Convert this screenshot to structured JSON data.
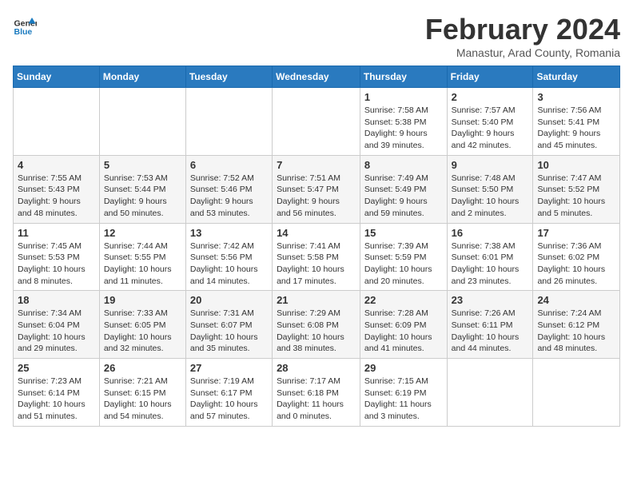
{
  "logo": {
    "line1": "General",
    "line2": "Blue"
  },
  "title": "February 2024",
  "subtitle": "Manastur, Arad County, Romania",
  "weekdays": [
    "Sunday",
    "Monday",
    "Tuesday",
    "Wednesday",
    "Thursday",
    "Friday",
    "Saturday"
  ],
  "weeks": [
    [
      {
        "day": "",
        "info": ""
      },
      {
        "day": "",
        "info": ""
      },
      {
        "day": "",
        "info": ""
      },
      {
        "day": "",
        "info": ""
      },
      {
        "day": "1",
        "info": "Sunrise: 7:58 AM\nSunset: 5:38 PM\nDaylight: 9 hours\nand 39 minutes."
      },
      {
        "day": "2",
        "info": "Sunrise: 7:57 AM\nSunset: 5:40 PM\nDaylight: 9 hours\nand 42 minutes."
      },
      {
        "day": "3",
        "info": "Sunrise: 7:56 AM\nSunset: 5:41 PM\nDaylight: 9 hours\nand 45 minutes."
      }
    ],
    [
      {
        "day": "4",
        "info": "Sunrise: 7:55 AM\nSunset: 5:43 PM\nDaylight: 9 hours\nand 48 minutes."
      },
      {
        "day": "5",
        "info": "Sunrise: 7:53 AM\nSunset: 5:44 PM\nDaylight: 9 hours\nand 50 minutes."
      },
      {
        "day": "6",
        "info": "Sunrise: 7:52 AM\nSunset: 5:46 PM\nDaylight: 9 hours\nand 53 minutes."
      },
      {
        "day": "7",
        "info": "Sunrise: 7:51 AM\nSunset: 5:47 PM\nDaylight: 9 hours\nand 56 minutes."
      },
      {
        "day": "8",
        "info": "Sunrise: 7:49 AM\nSunset: 5:49 PM\nDaylight: 9 hours\nand 59 minutes."
      },
      {
        "day": "9",
        "info": "Sunrise: 7:48 AM\nSunset: 5:50 PM\nDaylight: 10 hours\nand 2 minutes."
      },
      {
        "day": "10",
        "info": "Sunrise: 7:47 AM\nSunset: 5:52 PM\nDaylight: 10 hours\nand 5 minutes."
      }
    ],
    [
      {
        "day": "11",
        "info": "Sunrise: 7:45 AM\nSunset: 5:53 PM\nDaylight: 10 hours\nand 8 minutes."
      },
      {
        "day": "12",
        "info": "Sunrise: 7:44 AM\nSunset: 5:55 PM\nDaylight: 10 hours\nand 11 minutes."
      },
      {
        "day": "13",
        "info": "Sunrise: 7:42 AM\nSunset: 5:56 PM\nDaylight: 10 hours\nand 14 minutes."
      },
      {
        "day": "14",
        "info": "Sunrise: 7:41 AM\nSunset: 5:58 PM\nDaylight: 10 hours\nand 17 minutes."
      },
      {
        "day": "15",
        "info": "Sunrise: 7:39 AM\nSunset: 5:59 PM\nDaylight: 10 hours\nand 20 minutes."
      },
      {
        "day": "16",
        "info": "Sunrise: 7:38 AM\nSunset: 6:01 PM\nDaylight: 10 hours\nand 23 minutes."
      },
      {
        "day": "17",
        "info": "Sunrise: 7:36 AM\nSunset: 6:02 PM\nDaylight: 10 hours\nand 26 minutes."
      }
    ],
    [
      {
        "day": "18",
        "info": "Sunrise: 7:34 AM\nSunset: 6:04 PM\nDaylight: 10 hours\nand 29 minutes."
      },
      {
        "day": "19",
        "info": "Sunrise: 7:33 AM\nSunset: 6:05 PM\nDaylight: 10 hours\nand 32 minutes."
      },
      {
        "day": "20",
        "info": "Sunrise: 7:31 AM\nSunset: 6:07 PM\nDaylight: 10 hours\nand 35 minutes."
      },
      {
        "day": "21",
        "info": "Sunrise: 7:29 AM\nSunset: 6:08 PM\nDaylight: 10 hours\nand 38 minutes."
      },
      {
        "day": "22",
        "info": "Sunrise: 7:28 AM\nSunset: 6:09 PM\nDaylight: 10 hours\nand 41 minutes."
      },
      {
        "day": "23",
        "info": "Sunrise: 7:26 AM\nSunset: 6:11 PM\nDaylight: 10 hours\nand 44 minutes."
      },
      {
        "day": "24",
        "info": "Sunrise: 7:24 AM\nSunset: 6:12 PM\nDaylight: 10 hours\nand 48 minutes."
      }
    ],
    [
      {
        "day": "25",
        "info": "Sunrise: 7:23 AM\nSunset: 6:14 PM\nDaylight: 10 hours\nand 51 minutes."
      },
      {
        "day": "26",
        "info": "Sunrise: 7:21 AM\nSunset: 6:15 PM\nDaylight: 10 hours\nand 54 minutes."
      },
      {
        "day": "27",
        "info": "Sunrise: 7:19 AM\nSunset: 6:17 PM\nDaylight: 10 hours\nand 57 minutes."
      },
      {
        "day": "28",
        "info": "Sunrise: 7:17 AM\nSunset: 6:18 PM\nDaylight: 11 hours\nand 0 minutes."
      },
      {
        "day": "29",
        "info": "Sunrise: 7:15 AM\nSunset: 6:19 PM\nDaylight: 11 hours\nand 3 minutes."
      },
      {
        "day": "",
        "info": ""
      },
      {
        "day": "",
        "info": ""
      }
    ]
  ]
}
